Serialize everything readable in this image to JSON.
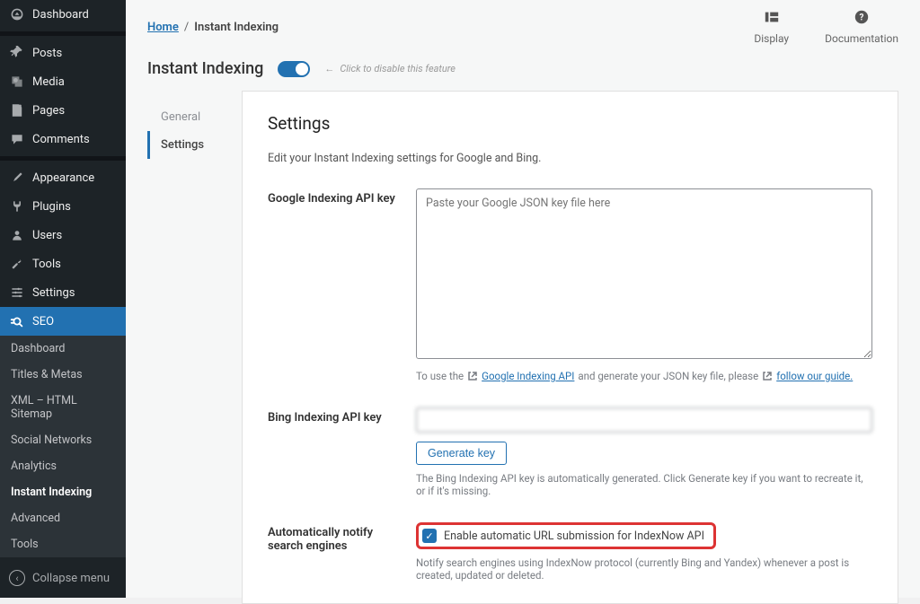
{
  "sidebar": {
    "items": [
      {
        "icon": "dashboard",
        "label": "Dashboard"
      },
      {
        "icon": "posts",
        "label": "Posts"
      },
      {
        "icon": "media",
        "label": "Media"
      },
      {
        "icon": "pages",
        "label": "Pages"
      },
      {
        "icon": "comments",
        "label": "Comments"
      },
      {
        "icon": "appearance",
        "label": "Appearance"
      },
      {
        "icon": "plugins",
        "label": "Plugins"
      },
      {
        "icon": "users",
        "label": "Users"
      },
      {
        "icon": "tools",
        "label": "Tools"
      },
      {
        "icon": "settings",
        "label": "Settings"
      },
      {
        "icon": "seo",
        "label": "SEO"
      }
    ],
    "submenu": [
      "Dashboard",
      "Titles & Metas",
      "XML – HTML Sitemap",
      "Social Networks",
      "Analytics",
      "Instant Indexing",
      "Advanced",
      "Tools"
    ],
    "submenu_current": "Instant Indexing",
    "collapse": "Collapse menu"
  },
  "breadcrumb": {
    "home": "Home",
    "current": "Instant Indexing"
  },
  "topactions": {
    "display": "Display",
    "docs": "Documentation"
  },
  "page_title": "Instant Indexing",
  "toggle_hint": "Click to disable this feature",
  "subtabs": {
    "general": "General",
    "settings": "Settings"
  },
  "panel": {
    "heading": "Settings",
    "desc": "Edit your Instant Indexing settings for Google and Bing.",
    "google": {
      "label": "Google Indexing API key",
      "placeholder": "Paste your Google JSON key file here",
      "help_pre": "To use the",
      "help_link1": "Google Indexing API",
      "help_mid": "and generate your JSON key file, please",
      "help_link2": "follow our guide."
    },
    "bing": {
      "label": "Bing Indexing API key",
      "value": "",
      "button": "Generate key",
      "help": "The Bing Indexing API key is automatically generated. Click Generate key if you want to recreate it, or if it's missing."
    },
    "auto": {
      "label": "Automatically notify search engines",
      "checkbox_label": "Enable automatic URL submission for IndexNow API",
      "help": "Notify search engines using IndexNow protocol (currently Bing and Yandex) whenever a post is created, updated or deleted."
    }
  }
}
